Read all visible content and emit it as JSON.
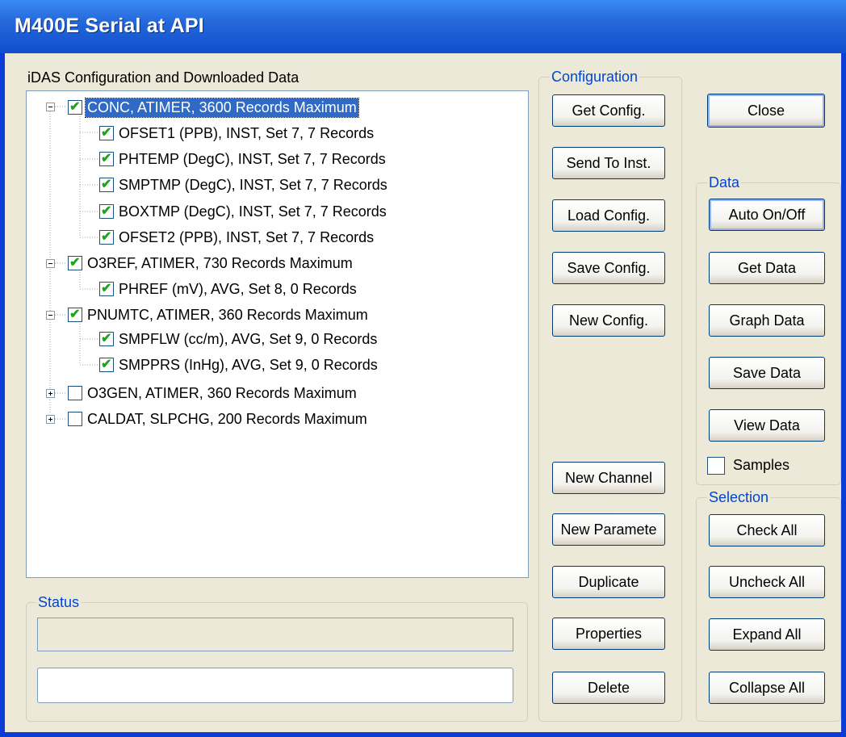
{
  "window": {
    "title": "M400E Serial at API"
  },
  "tree_section": {
    "label": "iDAS Configuration and Downloaded Data",
    "nodes": [
      {
        "text": "CONC, ATIMER, 3600 Records Maximum",
        "checked": true,
        "expanded": true,
        "selected": true,
        "children": [
          {
            "text": "OFSET1 (PPB), INST, Set 7, 7 Records",
            "checked": true
          },
          {
            "text": "PHTEMP (DegC), INST, Set 7, 7 Records",
            "checked": true
          },
          {
            "text": "SMPTMP (DegC), INST, Set 7, 7 Records",
            "checked": true
          },
          {
            "text": "BOXTMP (DegC), INST, Set 7, 7 Records",
            "checked": true
          },
          {
            "text": "OFSET2 (PPB), INST, Set 7, 7 Records",
            "checked": true
          }
        ]
      },
      {
        "text": "O3REF, ATIMER, 730 Records Maximum",
        "checked": true,
        "expanded": true,
        "children": [
          {
            "text": "PHREF (mV), AVG, Set 8, 0 Records",
            "checked": true
          }
        ]
      },
      {
        "text": "PNUMTC, ATIMER, 360 Records Maximum",
        "checked": true,
        "expanded": true,
        "children": [
          {
            "text": "SMPFLW (cc/m), AVG, Set 9, 0 Records",
            "checked": true
          },
          {
            "text": "SMPPRS (InHg), AVG, Set 9, 0 Records",
            "checked": true
          }
        ]
      },
      {
        "text": "O3GEN, ATIMER, 360 Records Maximum",
        "checked": false,
        "expanded": false,
        "children": []
      },
      {
        "text": "CALDAT, SLPCHG, 200 Records Maximum",
        "checked": false,
        "expanded": false,
        "children": []
      }
    ]
  },
  "status": {
    "label": "Status",
    "field_value": "",
    "input_value": ""
  },
  "configuration": {
    "label": "Configuration",
    "get_config": "Get Config.",
    "send_to_inst": "Send To Inst.",
    "load_config": "Load Config.",
    "save_config": "Save Config.",
    "new_config": "New Config.",
    "new_channel": "New Channel",
    "new_parameter": "New Paramete",
    "duplicate": "Duplicate",
    "properties": "Properties",
    "delete": "Delete"
  },
  "close_button": "Close",
  "data_group": {
    "label": "Data",
    "auto_on_off": "Auto On/Off",
    "get_data": "Get Data",
    "graph_data": "Graph Data",
    "save_data": "Save Data",
    "view_data": "View Data",
    "samples_label": "Samples",
    "samples_checked": false
  },
  "selection_group": {
    "label": "Selection",
    "check_all": "Check All",
    "uncheck_all": "Uncheck All",
    "expand_all": "Expand All",
    "collapse_all": "Collapse All"
  },
  "colors": {
    "title_bar": "#0F4FCF",
    "window_bg": "#ECE9D8",
    "group_label": "#0046D5",
    "selection": "#316AC5",
    "check": "#21A121"
  }
}
